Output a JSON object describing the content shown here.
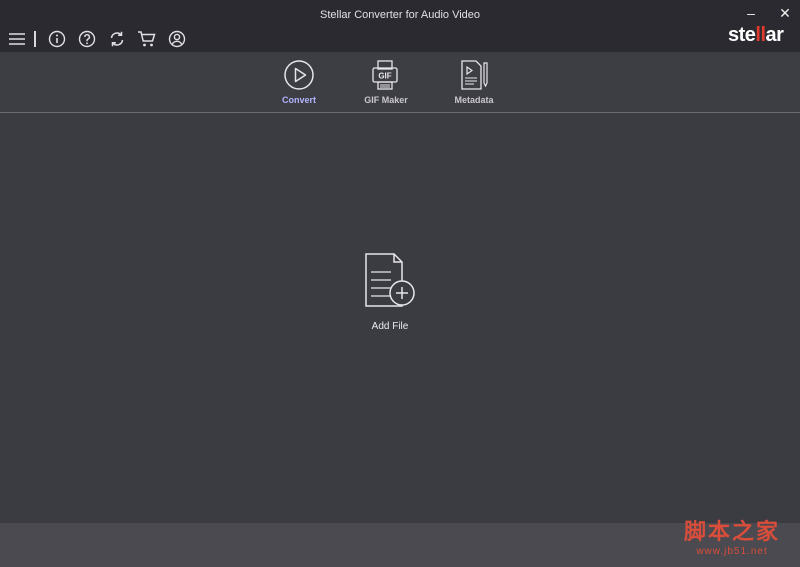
{
  "window": {
    "title": "Stellar Converter for Audio Video",
    "minimize_glyph": "–",
    "close_glyph": "✕"
  },
  "toolbar": {
    "icons": [
      "menu-icon",
      "info-icon",
      "help-icon",
      "refresh-icon",
      "cart-icon",
      "account-icon"
    ]
  },
  "brand": {
    "part1": "ste",
    "part2": "ll",
    "part3": "ar",
    "accent_color": "#e03a2e"
  },
  "tabs": [
    {
      "label": "Convert",
      "icon": "play-circle-icon",
      "active": true
    },
    {
      "label": "GIF Maker",
      "icon": "gif-printer-icon",
      "active": false
    },
    {
      "label": "Metadata",
      "icon": "metadata-doc-icon",
      "active": false
    }
  ],
  "main": {
    "add_file_label": "Add File",
    "add_file_icon": "add-file-icon"
  },
  "watermark": {
    "main": "脚本之家",
    "sub": "www.jb51.net"
  },
  "colors": {
    "titlebar": "#2a2a30",
    "background": "#3b3b42",
    "footer": "#4a4a50",
    "active_tab": "#b3b3ff"
  }
}
